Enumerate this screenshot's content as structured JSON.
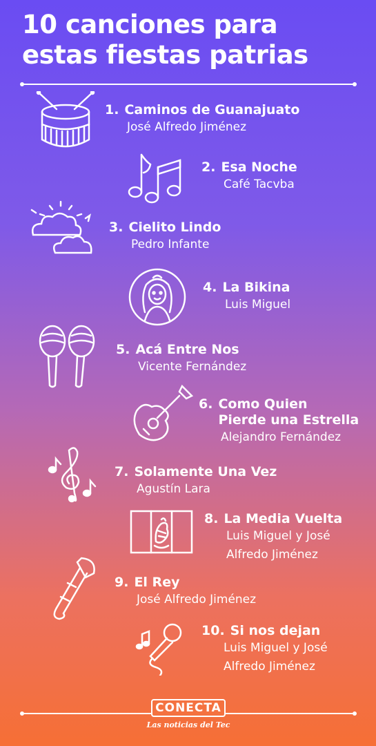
{
  "title": {
    "line1": "10 canciones para",
    "line2": "estas fiestas patrias"
  },
  "songs": [
    {
      "num": "1.",
      "title": "Caminos de Guanajuato",
      "artist": "José Alfredo Jiménez",
      "icon": "drum-icon"
    },
    {
      "num": "2.",
      "title": "Esa Noche",
      "artist": "Café Tacvba",
      "icon": "music-notes-icon"
    },
    {
      "num": "3.",
      "title": "Cielito Lindo",
      "artist": "Pedro Infante",
      "icon": "clouds-sun-icon"
    },
    {
      "num": "4.",
      "title": "La Bikina",
      "artist": "Luis Miguel",
      "icon": "woman-portrait-icon"
    },
    {
      "num": "5.",
      "title": "Acá Entre Nos",
      "artist": "Vicente Fernández",
      "icon": "maracas-icon"
    },
    {
      "num": "6.",
      "title": "Como Quien Pierde una Estrella",
      "artist": "Alejandro Fernández",
      "icon": "guitar-icon"
    },
    {
      "num": "7.",
      "title": "Solamente Una Vez",
      "artist": "Agustín Lara",
      "icon": "treble-clef-icon"
    },
    {
      "num": "8.",
      "title": "La Media Vuelta",
      "artist": "Luis Miguel y José Alfredo Jiménez",
      "icon": "mexican-flag-icon"
    },
    {
      "num": "9.",
      "title": "El Rey",
      "artist": "José Alfredo Jiménez",
      "icon": "trombone-icon"
    },
    {
      "num": "10.",
      "title": "Si nos dejan",
      "artist": "Luis Miguel y José Alfredo Jiménez",
      "icon": "microphone-icon"
    }
  ],
  "song6_title_lines": [
    "Como Quien",
    "Pierde una Estrella"
  ],
  "song8_artist_lines": [
    "Luis Miguel y José",
    "Alfredo Jiménez"
  ],
  "song10_artist_lines": [
    "Luis Miguel y José",
    "Alfredo Jiménez"
  ],
  "footer": {
    "logo": "CONECTA",
    "tagline": "Las noticias del Tec"
  },
  "colors": {
    "gradient_top": "#6a4cf3",
    "gradient_bottom": "#f66f35",
    "text": "#ffffff"
  }
}
